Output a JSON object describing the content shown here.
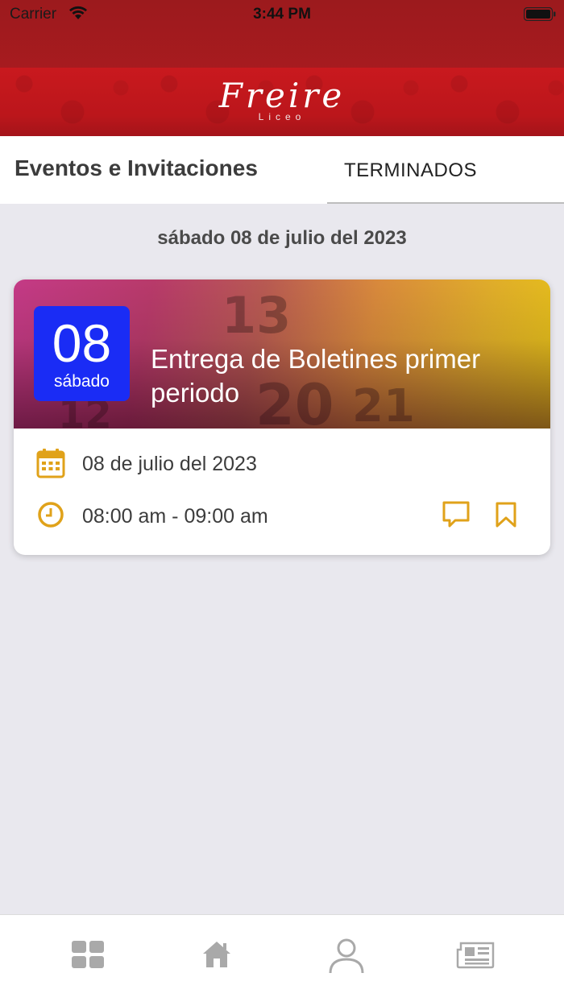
{
  "status_bar": {
    "carrier": "Carrier",
    "time": "3:44 PM"
  },
  "header": {
    "logo": "Freire",
    "logo_sub": "Liceo"
  },
  "tabs": {
    "title": "Eventos e Invitaciones",
    "active_tab": "TERMINADOS"
  },
  "section": {
    "date_heading": "sábado 08 de julio del 2023"
  },
  "event": {
    "day_number": "08",
    "weekday": "sábado",
    "title": "Entrega de Boletines primer periodo",
    "date_text": "08 de julio del 2023",
    "time_text": "08:00 am - 09:00 am"
  },
  "bottom_nav": {
    "items": [
      {
        "icon": "grid-icon"
      },
      {
        "icon": "home-icon"
      },
      {
        "icon": "user-icon"
      },
      {
        "icon": "newspaper-icon"
      }
    ]
  },
  "colors": {
    "header_red": "#c0181c",
    "badge_blue": "#1a2cf5",
    "accent_gold": "#e0a21a",
    "nav_gray": "#a9a9a9"
  }
}
